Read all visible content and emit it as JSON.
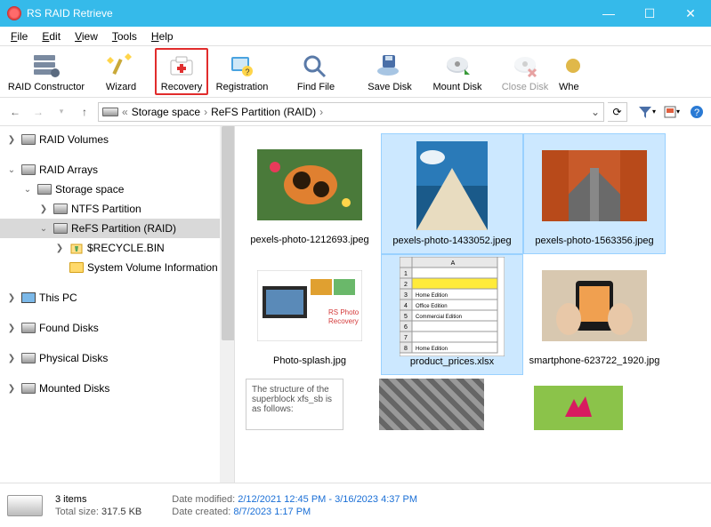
{
  "title": "RS RAID Retrieve",
  "menu": [
    "File",
    "Edit",
    "View",
    "Tools",
    "Help"
  ],
  "toolbar": [
    {
      "label": "RAID Constructor"
    },
    {
      "label": "Wizard"
    },
    {
      "label": "Recovery"
    },
    {
      "label": "Registration"
    },
    {
      "label": "Find File"
    },
    {
      "label": "Save Disk"
    },
    {
      "label": "Mount Disk"
    },
    {
      "label": "Close Disk"
    },
    {
      "label": "Whe"
    }
  ],
  "breadcrumb": {
    "prefix": "«",
    "parts": [
      "Storage space",
      "ReFS Partition (RAID)"
    ]
  },
  "tree": {
    "raid_volumes": "RAID Volumes",
    "raid_arrays": "RAID Arrays",
    "storage_space": "Storage space",
    "ntfs": "NTFS Partition",
    "refs": "ReFS Partition (RAID)",
    "recycle": "$RECYCLE.BIN",
    "sysvol": "System Volume Information",
    "this_pc": "This PC",
    "found": "Found Disks",
    "physical": "Physical Disks",
    "mounted": "Mounted Disks"
  },
  "files": [
    {
      "name": "pexels-photo-1212693.jpeg",
      "sel": false,
      "kind": "photo1"
    },
    {
      "name": "pexels-photo-1433052.jpeg",
      "sel": true,
      "kind": "photo2"
    },
    {
      "name": "pexels-photo-1563356.jpeg",
      "sel": true,
      "kind": "photo3"
    },
    {
      "name": "Photo-splash.jpg",
      "sel": false,
      "kind": "collage"
    },
    {
      "name": "product_prices.xlsx",
      "sel": true,
      "kind": "sheet"
    },
    {
      "name": "smartphone-623722_1920.jpg",
      "sel": false,
      "kind": "phone"
    }
  ],
  "sheet_rows": [
    "",
    "",
    "Home Edition",
    "Office Edition",
    "Commercial Edition",
    "",
    "",
    "Home Edition"
  ],
  "partial_text": "The structure of the superblock xfs_sb is as follows:",
  "status": {
    "count": "3 items",
    "size_label": "Total size:",
    "size": "317.5 KB",
    "mod_label": "Date modified:",
    "mod": "2/12/2021 12:45 PM - 3/16/2023 4:37 PM",
    "created_label": "Date created:",
    "created": "8/7/2023 1:17 PM"
  }
}
